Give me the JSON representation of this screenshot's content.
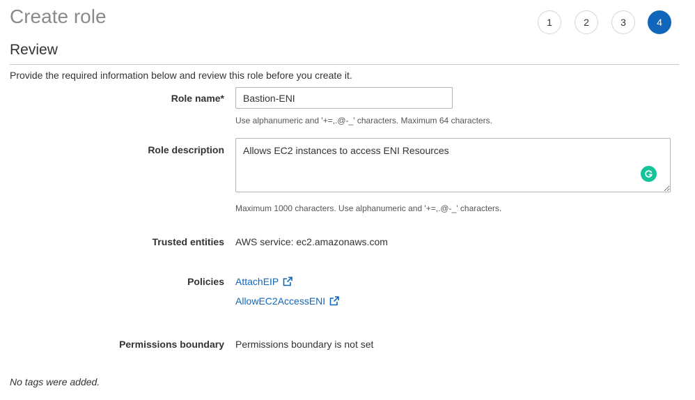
{
  "page": {
    "title": "Create role",
    "steps": [
      "1",
      "2",
      "3",
      "4"
    ],
    "active_step": "4"
  },
  "review": {
    "heading": "Review",
    "intro": "Provide the required information below and review this role before you create it."
  },
  "form": {
    "role_name": {
      "label": "Role name*",
      "value": "Bastion-ENI",
      "hint": "Use alphanumeric and '+=,.@-_' characters. Maximum 64 characters."
    },
    "role_description": {
      "label": "Role description",
      "value": "Allows EC2 instances to access ENI Resources",
      "hint": "Maximum 1000 characters. Use alphanumeric and '+=,.@-_' characters."
    },
    "trusted_entities": {
      "label": "Trusted entities",
      "value": "AWS service: ec2.amazonaws.com"
    },
    "policies": {
      "label": "Policies",
      "items": [
        "AttachEIP",
        "AllowEC2AccessENI"
      ]
    },
    "permissions_boundary": {
      "label": "Permissions boundary",
      "value": "Permissions boundary is not set"
    }
  },
  "tags": {
    "empty_text": "No tags were added."
  },
  "colors": {
    "accent": "#1166bb",
    "grammarly": "#15c39a"
  },
  "icons": [
    "external-link-icon",
    "grammarly-icon"
  ]
}
